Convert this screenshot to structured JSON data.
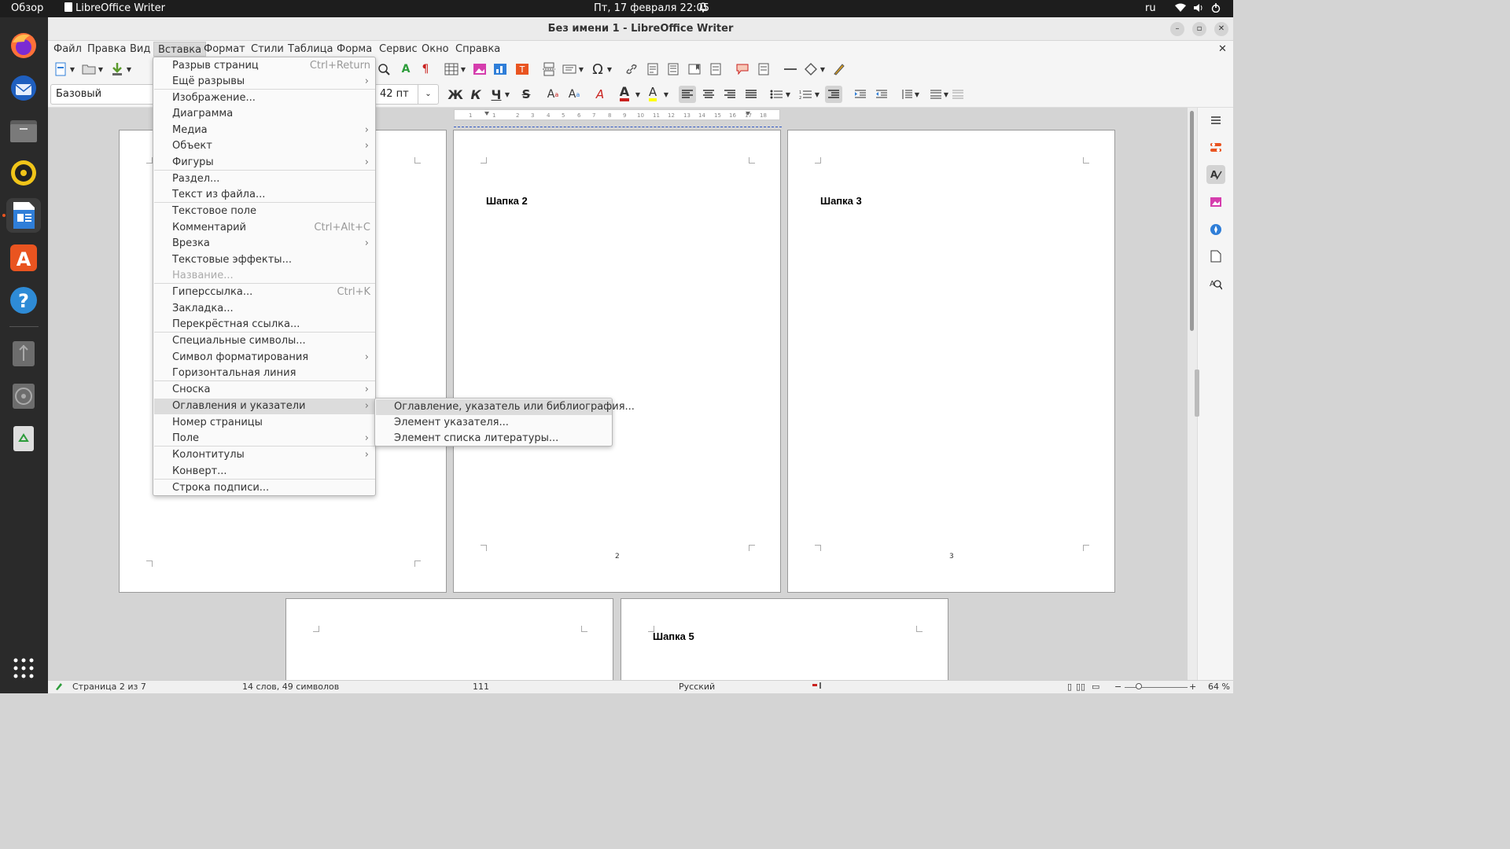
{
  "topbar": {
    "activities": "Обзор",
    "app_name": "LibreOffice Writer",
    "datetime": "Пт, 17 февраля  22:05",
    "lang": "ru"
  },
  "window": {
    "title": "Без имени 1 - LibreOffice Writer"
  },
  "menubar": {
    "items": [
      "Файл",
      "Правка",
      "Вид",
      "Вставка",
      "Формат",
      "Стили",
      "Таблица",
      "Форма",
      "Сервис",
      "Окно",
      "Справка"
    ],
    "open_index": 3
  },
  "formatting": {
    "paragraph_style": "Базовый",
    "font_size": "42 пт"
  },
  "insert_menu": {
    "items": [
      {
        "label": "Разрыв страниц",
        "shortcut": "Ctrl+Return"
      },
      {
        "label": "Ещё разрывы",
        "submenu": true
      },
      {
        "label": "Изображение..."
      },
      {
        "label": "Диаграмма"
      },
      {
        "label": "Медиа",
        "submenu": true
      },
      {
        "label": "Объект",
        "submenu": true
      },
      {
        "label": "Фигуры",
        "submenu": true
      },
      {
        "label": "Раздел..."
      },
      {
        "label": "Текст из файла..."
      },
      {
        "label": "Текстовое поле"
      },
      {
        "label": "Комментарий",
        "shortcut": "Ctrl+Alt+C"
      },
      {
        "label": "Врезка",
        "submenu": true
      },
      {
        "label": "Текстовые эффекты..."
      },
      {
        "label": "Название...",
        "disabled": true
      },
      {
        "label": "Гиперссылка...",
        "shortcut": "Ctrl+K"
      },
      {
        "label": "Закладка..."
      },
      {
        "label": "Перекрёстная ссылка..."
      },
      {
        "label": "Специальные символы..."
      },
      {
        "label": "Символ форматирования",
        "submenu": true
      },
      {
        "label": "Горизонтальная линия"
      },
      {
        "label": "Сноска",
        "submenu": true
      },
      {
        "label": "Оглавления и указатели",
        "submenu": true,
        "highlighted": true
      },
      {
        "label": "Номер страницы"
      },
      {
        "label": "Поле",
        "submenu": true
      },
      {
        "label": "Колонтитулы",
        "submenu": true
      },
      {
        "label": "Конверт..."
      },
      {
        "label": "Строка подписи..."
      }
    ],
    "arrow_glyph": "›"
  },
  "toc_submenu": {
    "items": [
      {
        "label": "Оглавление, указатель или библиография...",
        "highlighted": true
      },
      {
        "label": "Элемент указателя..."
      },
      {
        "label": "Элемент списка литературы..."
      }
    ]
  },
  "document": {
    "pages": [
      {
        "header": "",
        "number": ""
      },
      {
        "header": "Шапка 2",
        "number": "2"
      },
      {
        "header": "Шапка 3",
        "number": "3"
      },
      {
        "header": "",
        "number": ""
      },
      {
        "header": "Шапка 5",
        "number": ""
      }
    ]
  },
  "ruler": {
    "ticks": [
      "1",
      "1",
      "2",
      "3",
      "4",
      "5",
      "6",
      "7",
      "8",
      "9",
      "10",
      "11",
      "12",
      "13",
      "14",
      "15",
      "16",
      "17",
      "18"
    ]
  },
  "statusbar": {
    "page": "Страница 2 из 7",
    "words": "14 слов, 49 символов",
    "style_count": "111",
    "language": "Русский",
    "zoom": "64 %"
  },
  "icons": {
    "dock": [
      "firefox-icon",
      "thunderbird-icon",
      "files-icon",
      "rhythmbox-icon",
      "writer-icon",
      "software-icon",
      "help-icon",
      "usb-drive-icon",
      "disc-icon",
      "trash-icon",
      "app-grid-icon"
    ],
    "sidebar": [
      "sidebar-menu-icon",
      "properties-icon",
      "styles-icon",
      "gallery-icon",
      "navigator-icon",
      "page-icon",
      "find-replace-icon"
    ]
  },
  "colors": {
    "font_color": "#c9211e",
    "highlight_color": "#ffff00",
    "topbar": "#1d1d1d",
    "dock": "#2a2a2a"
  }
}
